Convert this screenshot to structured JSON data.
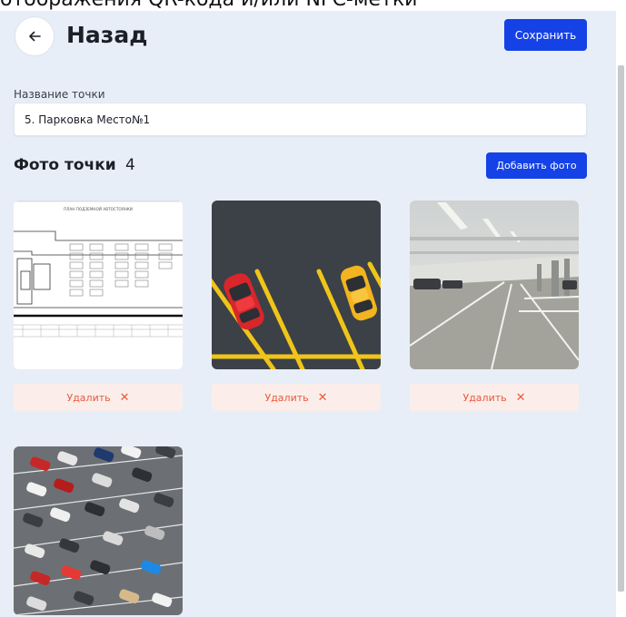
{
  "header": {
    "top_text": "отображения QR-кода и/или NFC-метки",
    "back_label": "Назад",
    "save_label": "Сохранить"
  },
  "form": {
    "name_label": "Название точки",
    "name_value": "5. Парковка Место№1"
  },
  "photos": {
    "title": "Фото точки",
    "count": "4",
    "add_label": "Добавить фото",
    "plan_caption": "ПЛАН ПОДЗЕМНОЙ АВТОСТОЯНКИ",
    "delete_label": "Удалить",
    "delete_icon": "close-icon"
  },
  "colors": {
    "accent": "#1542e6",
    "delete_bg": "#fbeeea",
    "delete_text": "#e7593f",
    "page_bg": "#e8eef8"
  }
}
